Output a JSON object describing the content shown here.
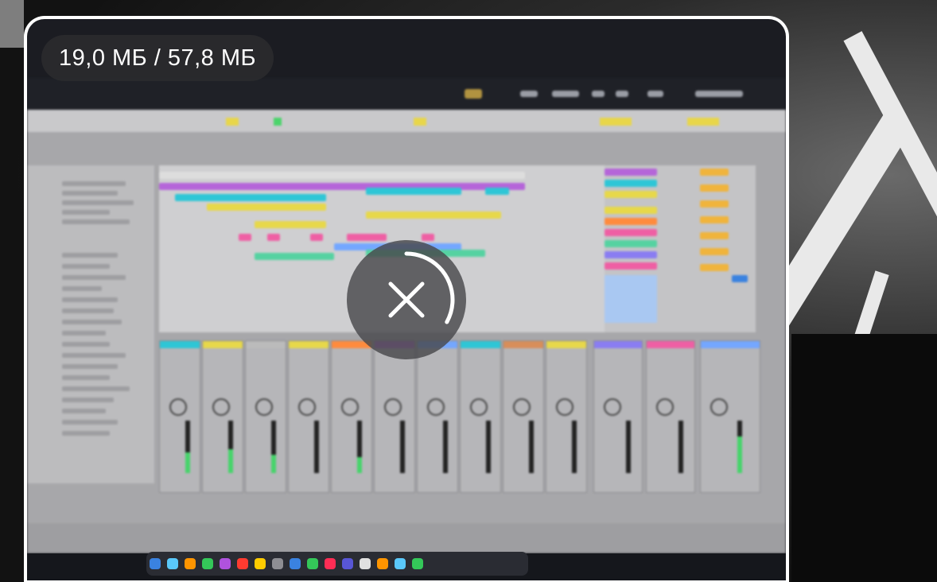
{
  "download": {
    "size_progress": "19,0 МБ / 57,8 МБ",
    "downloaded_mb": 19.0,
    "total_mb": 57.8,
    "progress_fraction": 0.33
  },
  "icons": {
    "cancel": "close-icon",
    "progress": "progress-ring-icon"
  },
  "colors": {
    "pill_bg": "#2d2d30",
    "cancel_bg": "#48484c",
    "ring": "#ffffff",
    "clip_colors": [
      "#b565d9",
      "#2ec6d6",
      "#e7d84a",
      "#ef5fa4",
      "#55d2a1",
      "#ff8b3d",
      "#8a7df2",
      "#74a7ff"
    ]
  }
}
